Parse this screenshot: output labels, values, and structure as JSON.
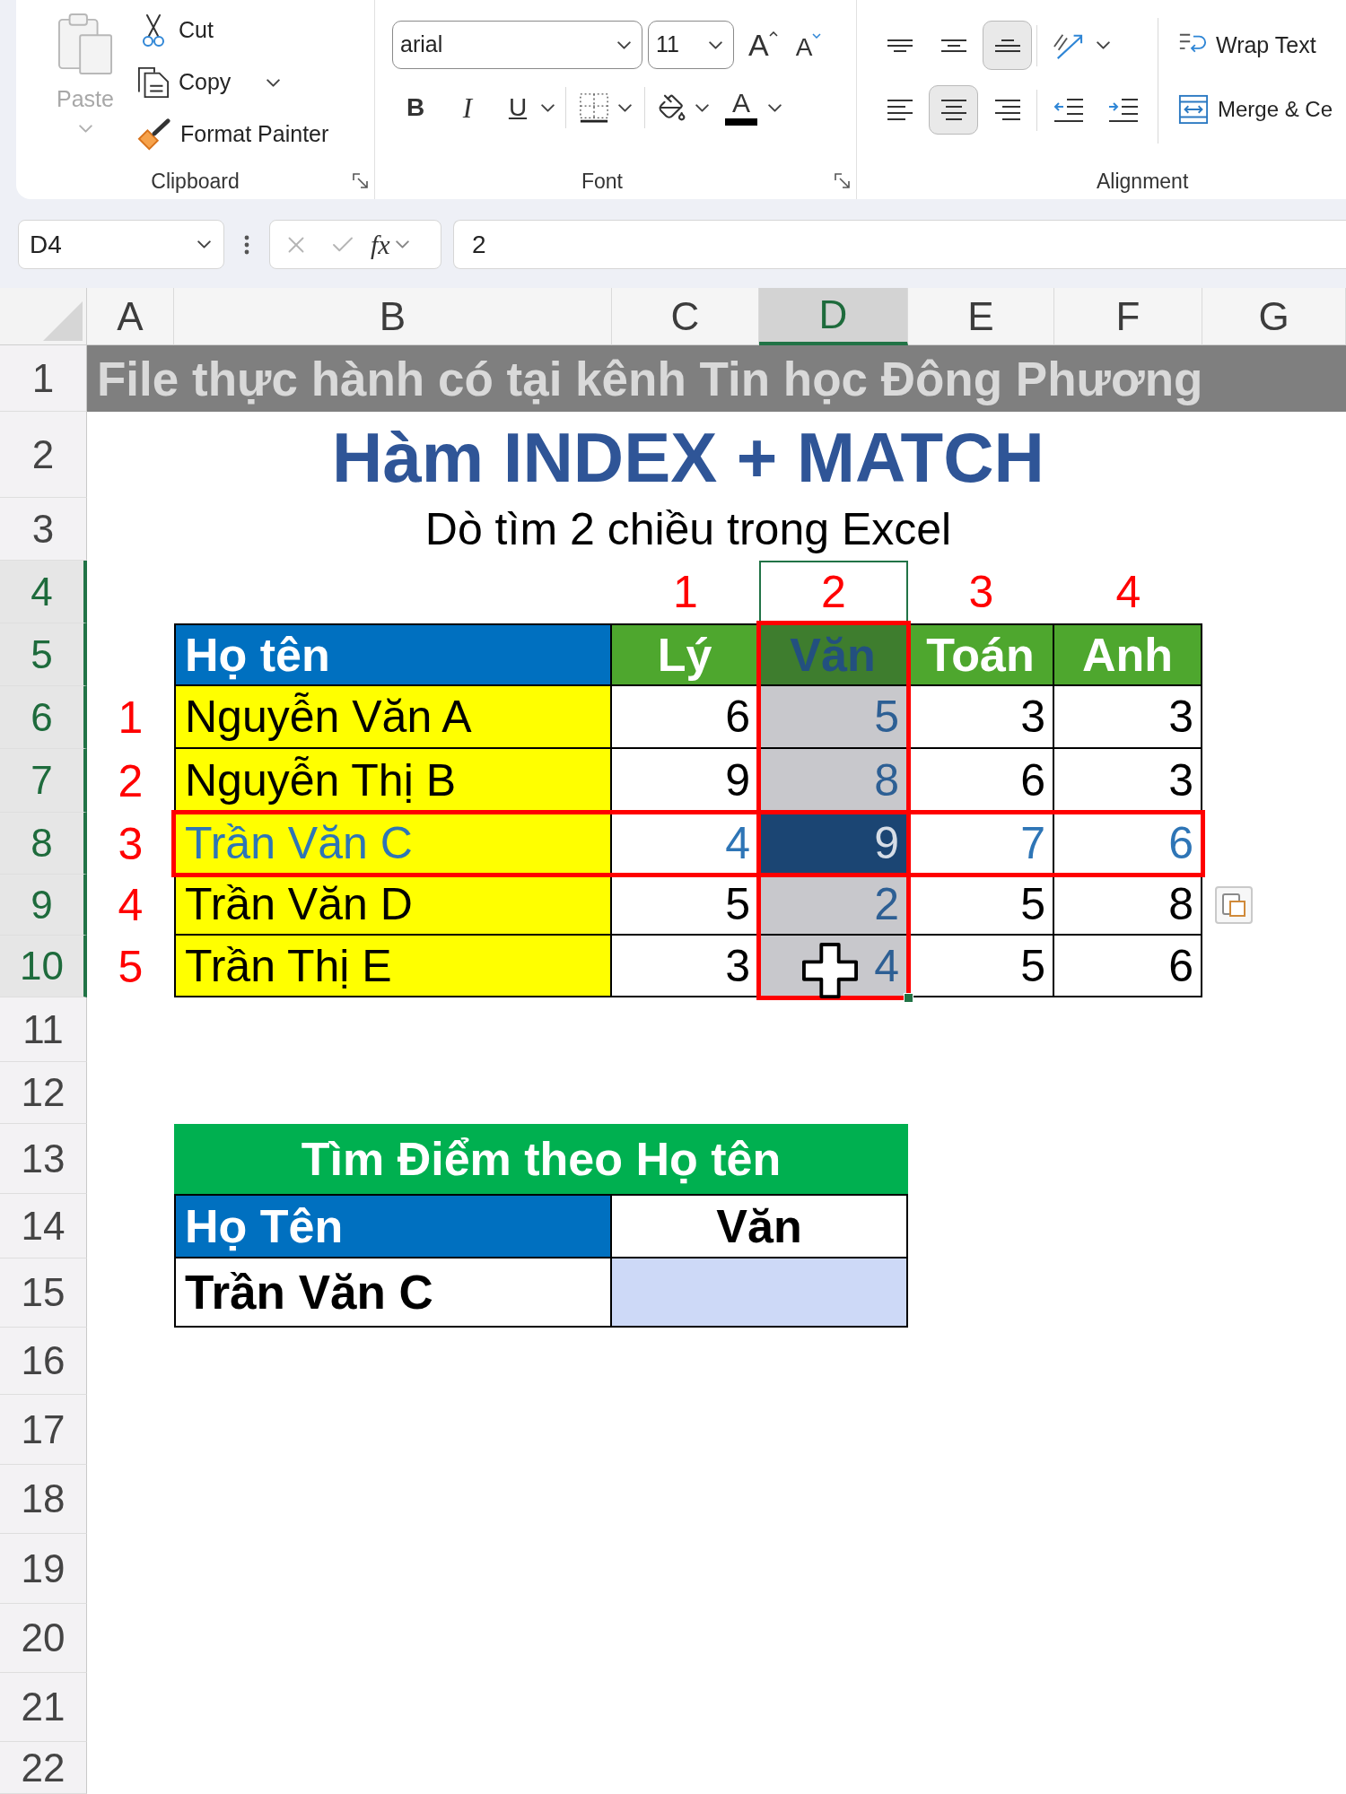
{
  "ribbon": {
    "clipboard": {
      "paste": {
        "label": "Paste",
        "disabled": true
      },
      "cut": "Cut",
      "copy": "Copy",
      "format_painter": "Format Painter",
      "group_label": "Clipboard"
    },
    "font": {
      "font_name": "arial",
      "font_size": "11",
      "grow_font": "A",
      "shrink_font": "A",
      "bold": "B",
      "italic": "I",
      "underline": "U",
      "font_color": "A",
      "group_label": "Font"
    },
    "alignment": {
      "vertical": [
        {
          "kind": "top",
          "selected": false
        },
        {
          "kind": "middle",
          "selected": false
        },
        {
          "kind": "bottom",
          "selected": true
        }
      ],
      "horizontal": [
        {
          "kind": "left",
          "selected": false
        },
        {
          "kind": "center",
          "selected": true
        },
        {
          "kind": "right",
          "selected": false
        }
      ],
      "wrap_text": "Wrap Text",
      "merge": "Merge & Ce",
      "group_label": "Alignment"
    }
  },
  "formula_bar": {
    "name_box": "D4",
    "function_label": "fx",
    "formula": "2"
  },
  "sheet": {
    "columns": [
      {
        "label": "A",
        "selected": false
      },
      {
        "label": "B",
        "selected": false
      },
      {
        "label": "C",
        "selected": false
      },
      {
        "label": "D",
        "selected": true
      },
      {
        "label": "E",
        "selected": false
      },
      {
        "label": "F",
        "selected": false
      },
      {
        "label": "G",
        "selected": false
      }
    ],
    "rows": [
      {
        "label": "1",
        "selected": false
      },
      {
        "label": "2",
        "selected": false
      },
      {
        "label": "3",
        "selected": false
      },
      {
        "label": "4",
        "selected": true
      },
      {
        "label": "5",
        "selected": true
      },
      {
        "label": "6",
        "selected": true
      },
      {
        "label": "7",
        "selected": true
      },
      {
        "label": "8",
        "selected": true
      },
      {
        "label": "9",
        "selected": true
      },
      {
        "label": "10",
        "selected": true
      },
      {
        "label": "11",
        "selected": false
      },
      {
        "label": "12",
        "selected": false
      },
      {
        "label": "13",
        "selected": false
      },
      {
        "label": "14",
        "selected": false
      },
      {
        "label": "15",
        "selected": false
      },
      {
        "label": "16",
        "selected": false
      },
      {
        "label": "17",
        "selected": false
      },
      {
        "label": "18",
        "selected": false
      },
      {
        "label": "19",
        "selected": false
      },
      {
        "label": "20",
        "selected": false
      },
      {
        "label": "21",
        "selected": false
      },
      {
        "label": "22",
        "selected": false
      }
    ],
    "banner": "File thực hành có tại kênh Tin học Đông Phương",
    "title": "Hàm INDEX + MATCH",
    "subtitle": "Dò tìm 2 chiều trong Excel",
    "column_numbers": [
      "1",
      "2",
      "3",
      "4"
    ],
    "score_table": {
      "name_header": "Họ tên",
      "subjects": [
        {
          "name": "Lý",
          "matched": false
        },
        {
          "name": "Văn",
          "matched": true
        },
        {
          "name": "Toán",
          "matched": false
        },
        {
          "name": "Anh",
          "matched": false
        }
      ],
      "rows": [
        {
          "number": "1",
          "name": "Nguyễn Văn A",
          "scores": [
            "6",
            "5",
            "3",
            "3"
          ],
          "matched": false
        },
        {
          "number": "2",
          "name": "Nguyễn Thị B",
          "scores": [
            "9",
            "8",
            "6",
            "3"
          ],
          "matched": false
        },
        {
          "number": "3",
          "name": "Trần Văn C",
          "scores": [
            "4",
            "9",
            "7",
            "6"
          ],
          "matched": true
        },
        {
          "number": "4",
          "name": "Trần Văn D",
          "scores": [
            "5",
            "2",
            "5",
            "8"
          ],
          "matched": false
        },
        {
          "number": "5",
          "name": "Trần Thị E",
          "scores": [
            "3",
            "4",
            "5",
            "6"
          ],
          "matched": false
        }
      ]
    },
    "lookup_table": {
      "title": "Tìm Điểm theo Họ tên",
      "name_header": "Họ Tên",
      "subject_header": "Văn",
      "name": "Trần Văn C"
    }
  }
}
